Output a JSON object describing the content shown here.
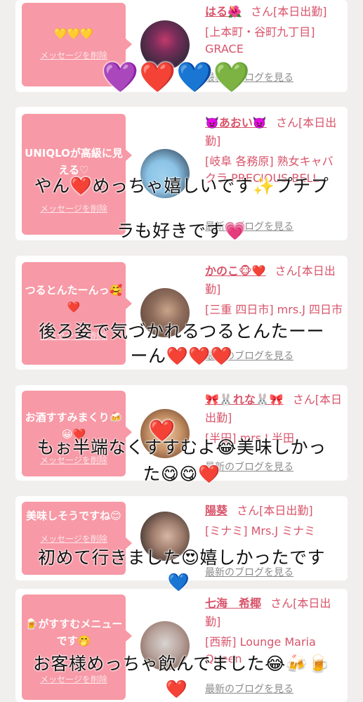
{
  "cards": [
    {
      "message": "💛💛💛",
      "delete_label": "メッセージを削除",
      "name": "はる🌺",
      "suffix": "さん[本日出勤]",
      "store": "[上本町・谷町九丁目] GRACE",
      "blog_label": "最新のブログを見る",
      "avatar_colors": [
        "#3b2a3f",
        "#c23a6b"
      ]
    },
    {
      "message": "UNIQLOが高級に見える♡",
      "delete_label": "メッセージを削除",
      "name": "👿あおい👿",
      "suffix": "さん[本日出勤]",
      "store": "[岐阜 各務原] 熟女キャバクラ PRECIOUS BELL",
      "blog_label": "最新のブログを見る",
      "avatar_colors": [
        "#9fd1ee",
        "#4d6b84"
      ]
    },
    {
      "message": "つるとんたーんっ🥰❤️",
      "delete_label": "メッセージを削除",
      "name": "かのこ🐵❤️",
      "suffix": "さん[本日出勤]",
      "store": "[三重 四日市] mrs.J 四日市",
      "blog_label": "最新のブログを見る",
      "avatar_colors": [
        "#6b5043",
        "#c9a48a"
      ]
    },
    {
      "message": "お酒すすみまくり🍻😀❤️",
      "delete_label": "メッセージを削除",
      "name": "🎀🐰れな🐰🎀",
      "suffix": "さん[本日出勤]",
      "store": "[半田] mrs.J 半田",
      "blog_label": "最新のブログを見る",
      "avatar_colors": [
        "#e8c49c",
        "#8a5a3a"
      ]
    },
    {
      "message": "美味しそうですね😊",
      "delete_label": "メッセージを削除",
      "name": "陽葵",
      "suffix": "さん[本日出勤]",
      "store": "[ミナミ] Mrs.J ミナミ",
      "blog_label": "最新のブログを見る",
      "avatar_colors": [
        "#4a3a34",
        "#d8b6a4"
      ]
    },
    {
      "message": "🍺がすすむメニューです🤭",
      "delete_label": "メッセージを削除",
      "name": "七海　希椰",
      "suffix": "さん[本日出勤]",
      "store": "[西新] Lounge Maria Queen",
      "blog_label": "最新のブログを見る",
      "avatar_colors": [
        "#d9d4d0",
        "#8b6d62"
      ]
    }
  ],
  "overlay": {
    "hearts": "💜❤️💙💚",
    "caption1_line1": "やん❤️めっちゃ嬉しいです✨プチプ",
    "caption1_line2": "ラも好きです💗",
    "caption2_line1": "後ろ姿で気づかれるつるとんたーー",
    "caption2_line2": "ーん❤️❤️❤️",
    "caption3_line1": "もぉ半端なくすすむよ😂美味しかっ",
    "caption3_line2": "た😋😋❤️",
    "caption4_line1": "初めて行きました😍嬉しかったです",
    "caption4_line2": "💙",
    "caption5_line1": "お客様めっちゃ飲んでました😂🍻🍺",
    "caption5_line2": "❤️",
    "avatar_heart": "❤️"
  }
}
